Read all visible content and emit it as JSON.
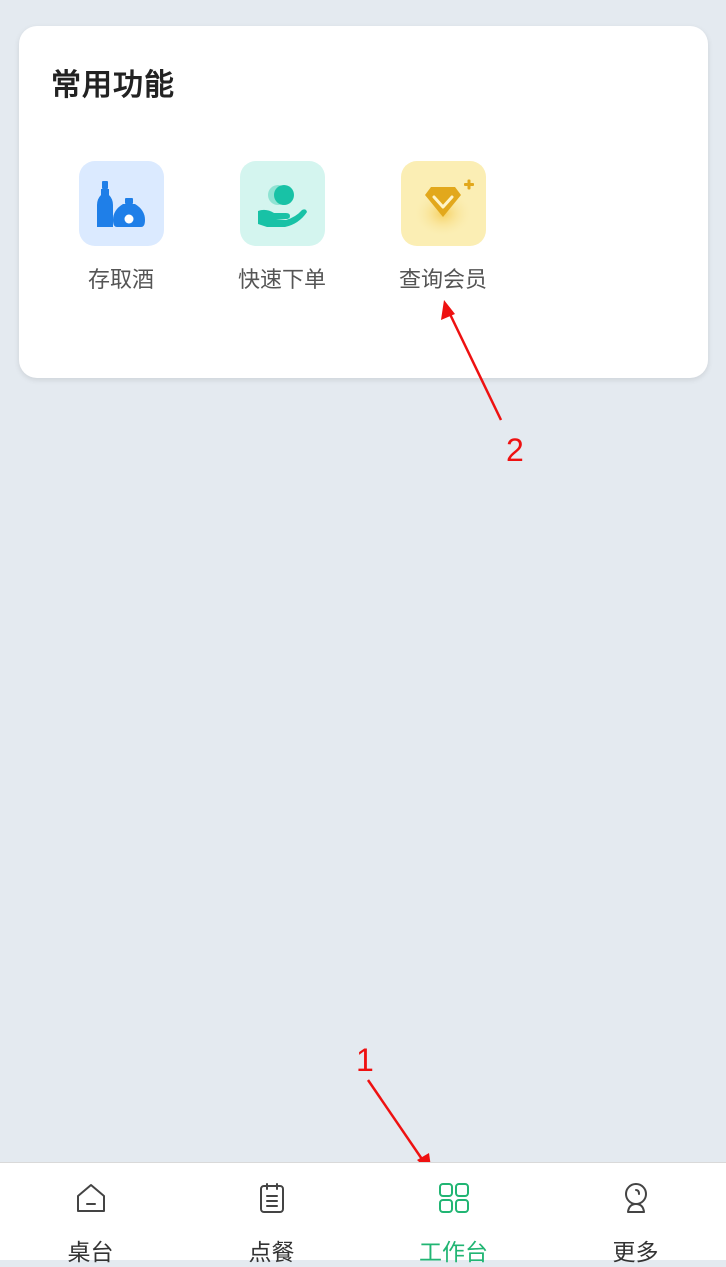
{
  "section": {
    "title": "常用功能",
    "functions": [
      {
        "label": "存取酒",
        "icon": "wine-bottles-icon"
      },
      {
        "label": "快速下单",
        "icon": "hand-coin-icon"
      },
      {
        "label": "查询会员",
        "icon": "diamond-icon"
      }
    ]
  },
  "annotations": [
    {
      "label": "1"
    },
    {
      "label": "2"
    }
  ],
  "tabbar": {
    "active_color": "#21b573",
    "tabs": [
      {
        "label": "桌台",
        "icon": "home-icon"
      },
      {
        "label": "点餐",
        "icon": "clipboard-icon"
      },
      {
        "label": "工作台",
        "icon": "grid-icon",
        "active": true
      },
      {
        "label": "更多",
        "icon": "user-icon"
      }
    ]
  }
}
